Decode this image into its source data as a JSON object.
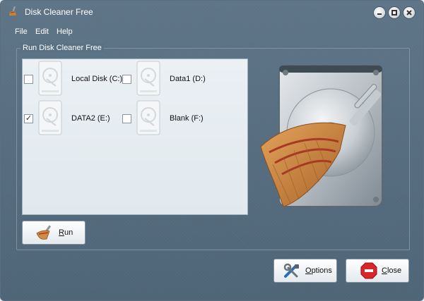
{
  "window": {
    "title": "Disk Cleaner Free"
  },
  "menu": {
    "items": [
      {
        "label": "File"
      },
      {
        "label": "Edit"
      },
      {
        "label": "Help"
      }
    ]
  },
  "group": {
    "label": "Run Disk Cleaner Free"
  },
  "drives": [
    {
      "label": "Local Disk (C:)",
      "checked": false
    },
    {
      "label": "Data1 (D:)",
      "checked": false
    },
    {
      "label": "DATA2 (E:)",
      "checked": true
    },
    {
      "label": "Blank (F:)",
      "checked": false
    }
  ],
  "buttons": {
    "run": "Run",
    "options": "Options",
    "close": "Close"
  },
  "icons": {
    "app": "broom-icon",
    "minimize": "minimize-icon",
    "maximize": "maximize-icon",
    "close": "close-icon",
    "drive": "hard-drive-icon",
    "run": "broom-icon",
    "options": "wrench-screwdriver-icon",
    "close_button": "stop-sign-icon",
    "hero": "hard-drive-broom-icon"
  },
  "colors": {
    "window_bg": "#566d7f",
    "panel_bg": "#e4ecf0",
    "stop_red": "#d8262b",
    "broom_straw": "#c9823a"
  }
}
